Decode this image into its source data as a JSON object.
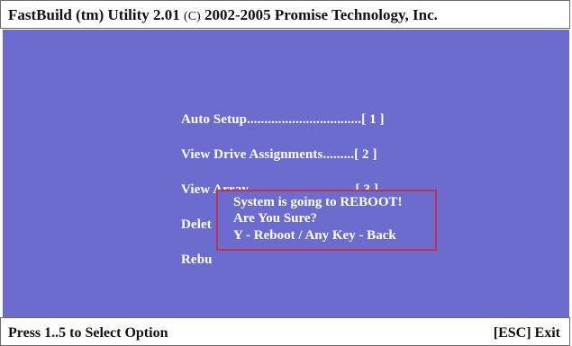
{
  "title_bar": {
    "title": "FastBuild (tm) Utility 2.01",
    "copyright_symbol": "(C)",
    "copyright": "2002-2005 Promise Technology, Inc."
  },
  "menu": {
    "items": [
      {
        "label": "Auto Setup.................................[ 1 ]"
      },
      {
        "label": "View Drive Assignments.........[ 2 ]"
      },
      {
        "label": "View Array...............................[ 3 ]"
      },
      {
        "label": "Delet"
      },
      {
        "label": "Rebu"
      }
    ]
  },
  "dialog": {
    "line1": "System is going to REBOOT!",
    "line2": "Are You Sure?",
    "line3": "Y - Reboot / Any Key - Back"
  },
  "status_bar": {
    "hint": "Press 1..5 to Select Option",
    "exit": "[ESC]  Exit"
  },
  "colors": {
    "screen_background": "#6b6ccd",
    "dialog_border": "#c2304f",
    "text_on_screen": "#ffffff",
    "bar_text": "#111111"
  }
}
